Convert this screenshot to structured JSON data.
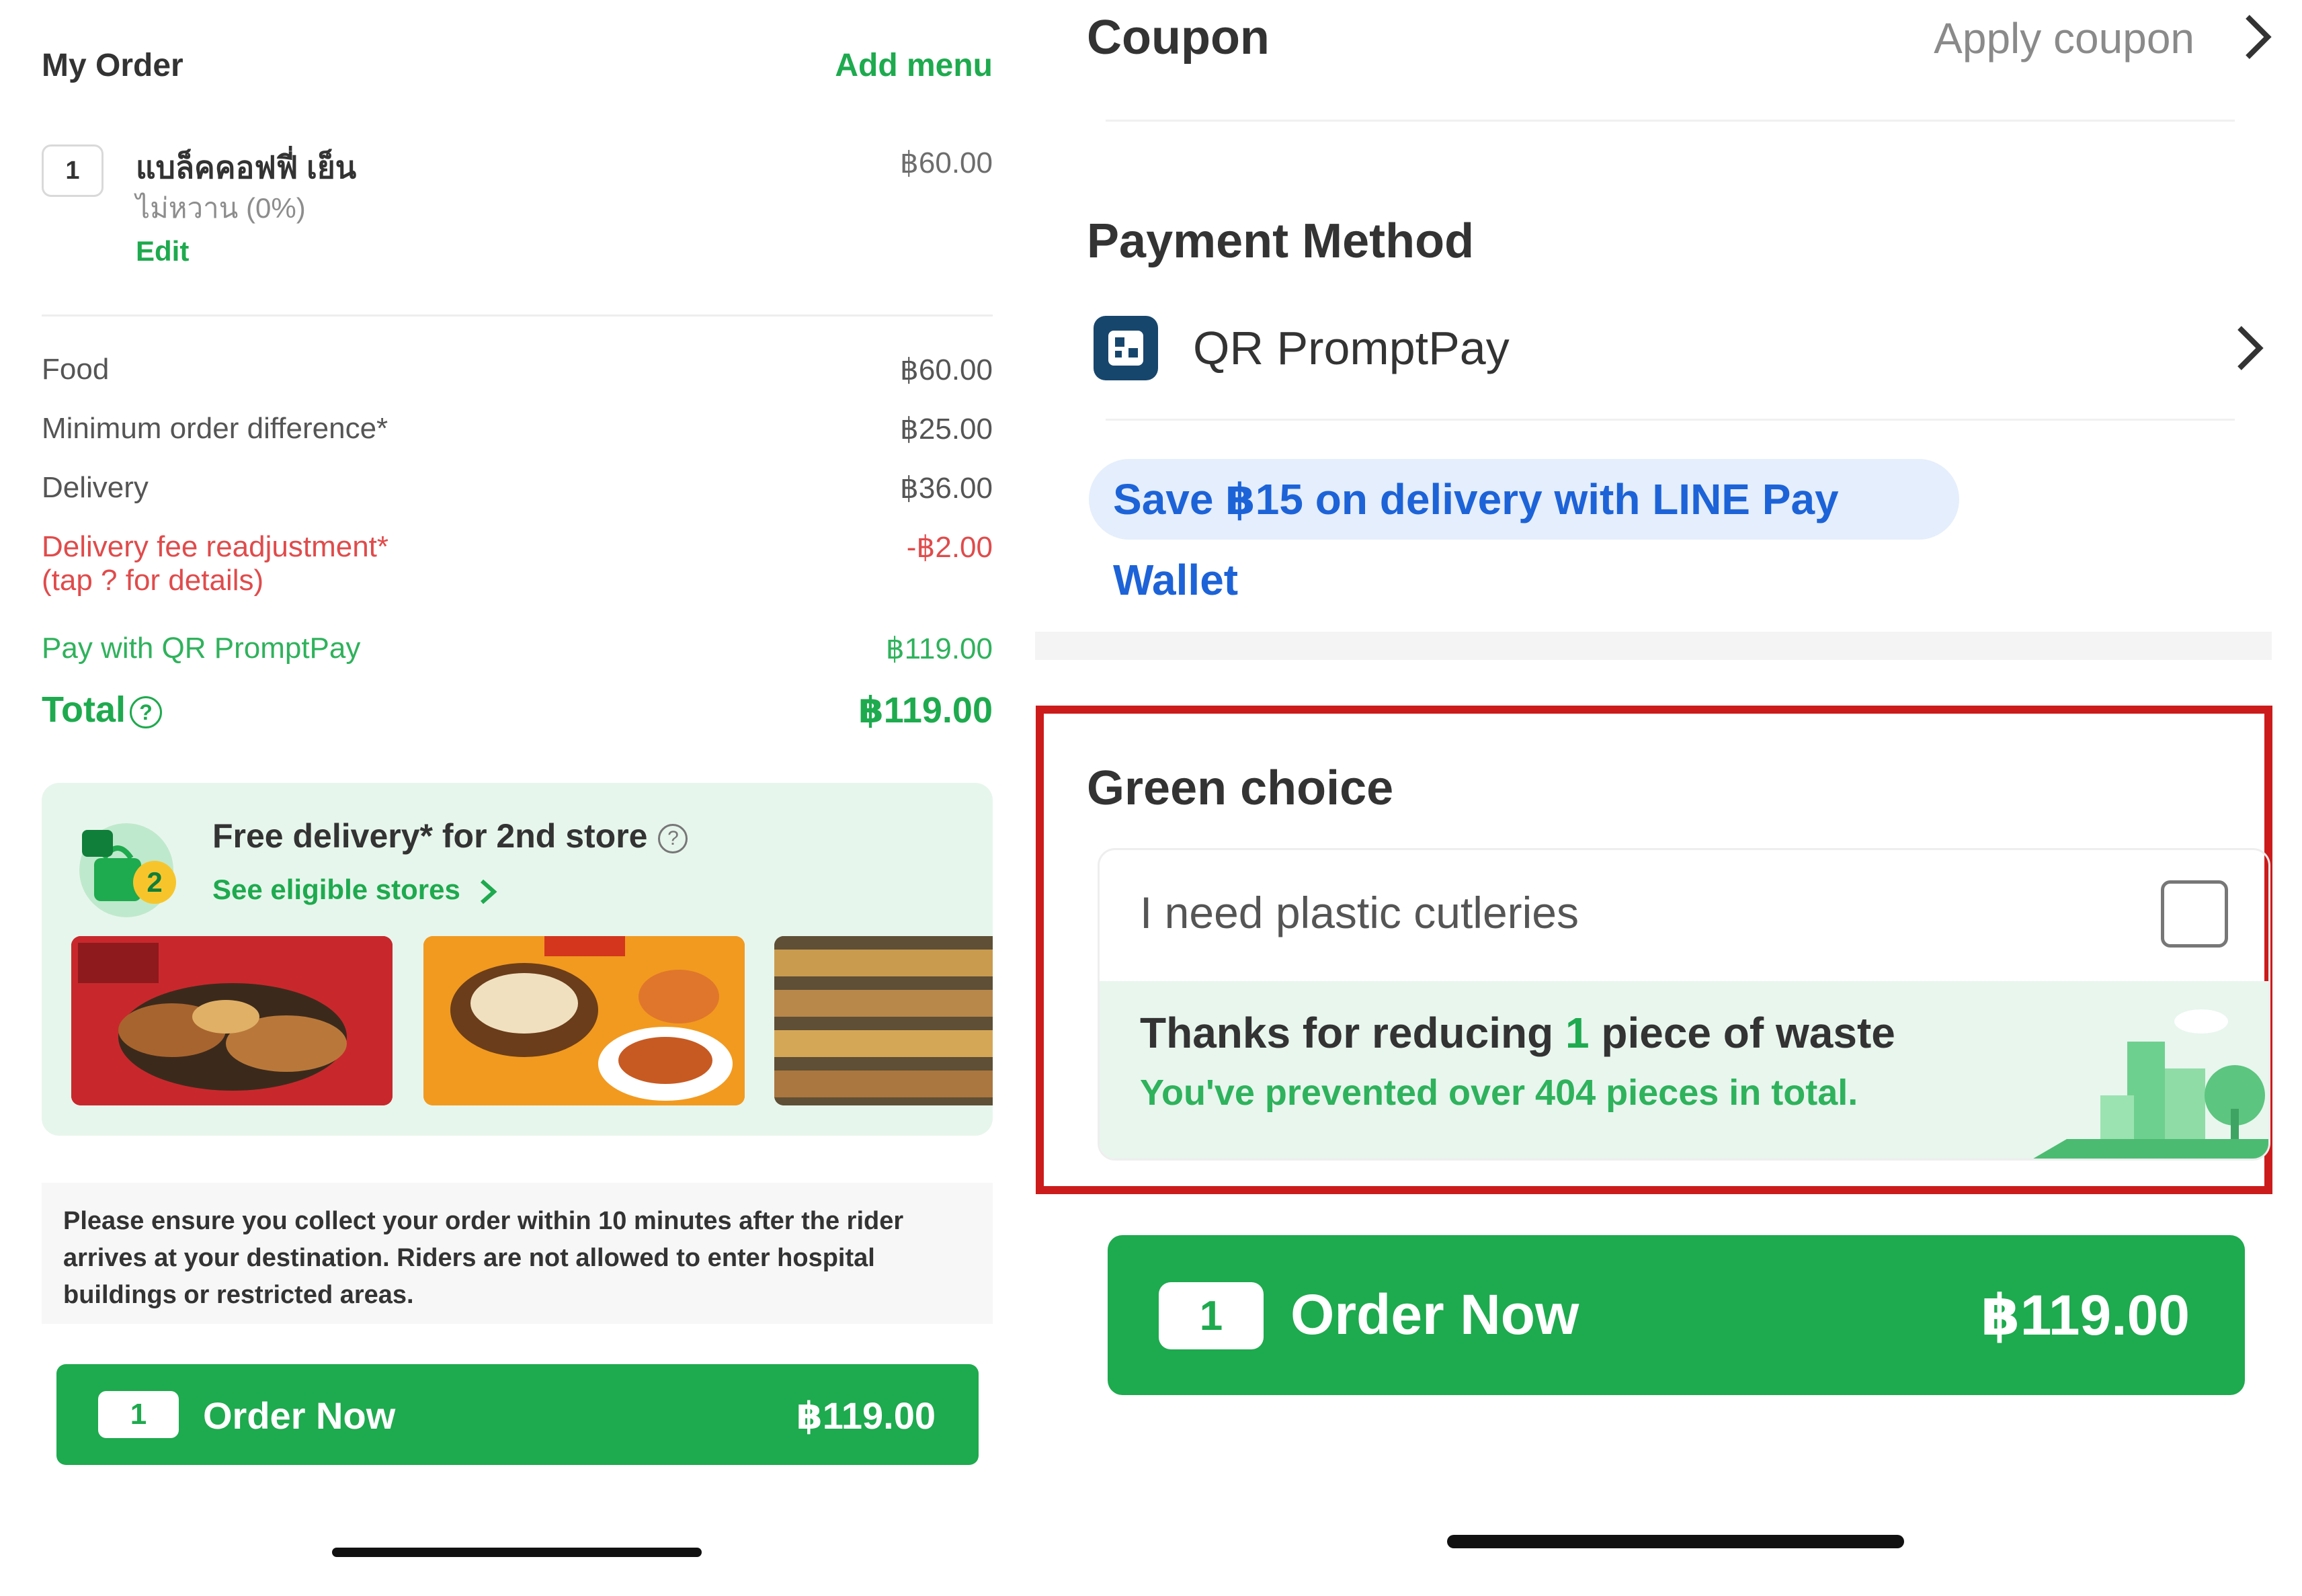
{
  "left": {
    "header": {
      "title": "My Order",
      "add_menu": "Add menu"
    },
    "item": {
      "quantity": "1",
      "name": "แบล็คคอฟฟี่ เย็น",
      "option": "ไม่หวาน (0%)",
      "edit": "Edit",
      "price": "฿60.00"
    },
    "summary": {
      "food_label": "Food",
      "food_value": "฿60.00",
      "min_label": "Minimum order difference*",
      "min_value": "฿25.00",
      "delivery_label": "Delivery",
      "delivery_value": "฿36.00",
      "readjust_label_1": "Delivery fee readjustment*",
      "readjust_label_2": "(tap ? for details)",
      "readjust_value": "-฿2.00",
      "pay_label": "Pay with QR PromptPay",
      "pay_value": "฿119.00",
      "total_label": "Total",
      "total_help": "?",
      "total_value": "฿119.00"
    },
    "promo": {
      "title": "Free delivery* for 2nd store",
      "help": "?",
      "link": "See eligible stores",
      "icon_badge": "2"
    },
    "notice": "Please ensure you collect your order within 10 minutes after the rider arrives at your destination. Riders are not allowed to enter hospital buildings or restricted areas.",
    "order_button": {
      "quantity": "1",
      "label": "Order Now",
      "price": "฿119.00"
    }
  },
  "right": {
    "coupon": {
      "title": "Coupon",
      "apply": "Apply coupon"
    },
    "payment": {
      "title": "Payment Method",
      "method": "QR PromptPay"
    },
    "line_pay_offer": "Save ฿15 on delivery with LINE Pay Wallet",
    "green_choice": {
      "title": "Green choice",
      "cutlery_label": "I need plastic cutleries",
      "cutlery_checked": false,
      "thanks_prefix": "Thanks for reducing ",
      "thanks_count": "1",
      "thanks_suffix": " piece of waste",
      "prevented": "You've prevented over 404 pieces in total."
    },
    "order_button": {
      "quantity": "1",
      "label": "Order Now",
      "price": "฿119.00"
    }
  },
  "colors": {
    "brand_green": "#1eaa4e",
    "alert_red": "#e04b4b",
    "highlight_border": "#cc1b1b",
    "link_blue": "#1d63d8"
  },
  "icons": [
    "chevron-right-icon",
    "qr-promptpay-icon",
    "help-circle-icon",
    "shopping-bag-icon",
    "checkbox-icon",
    "city-tree-illustration"
  ]
}
